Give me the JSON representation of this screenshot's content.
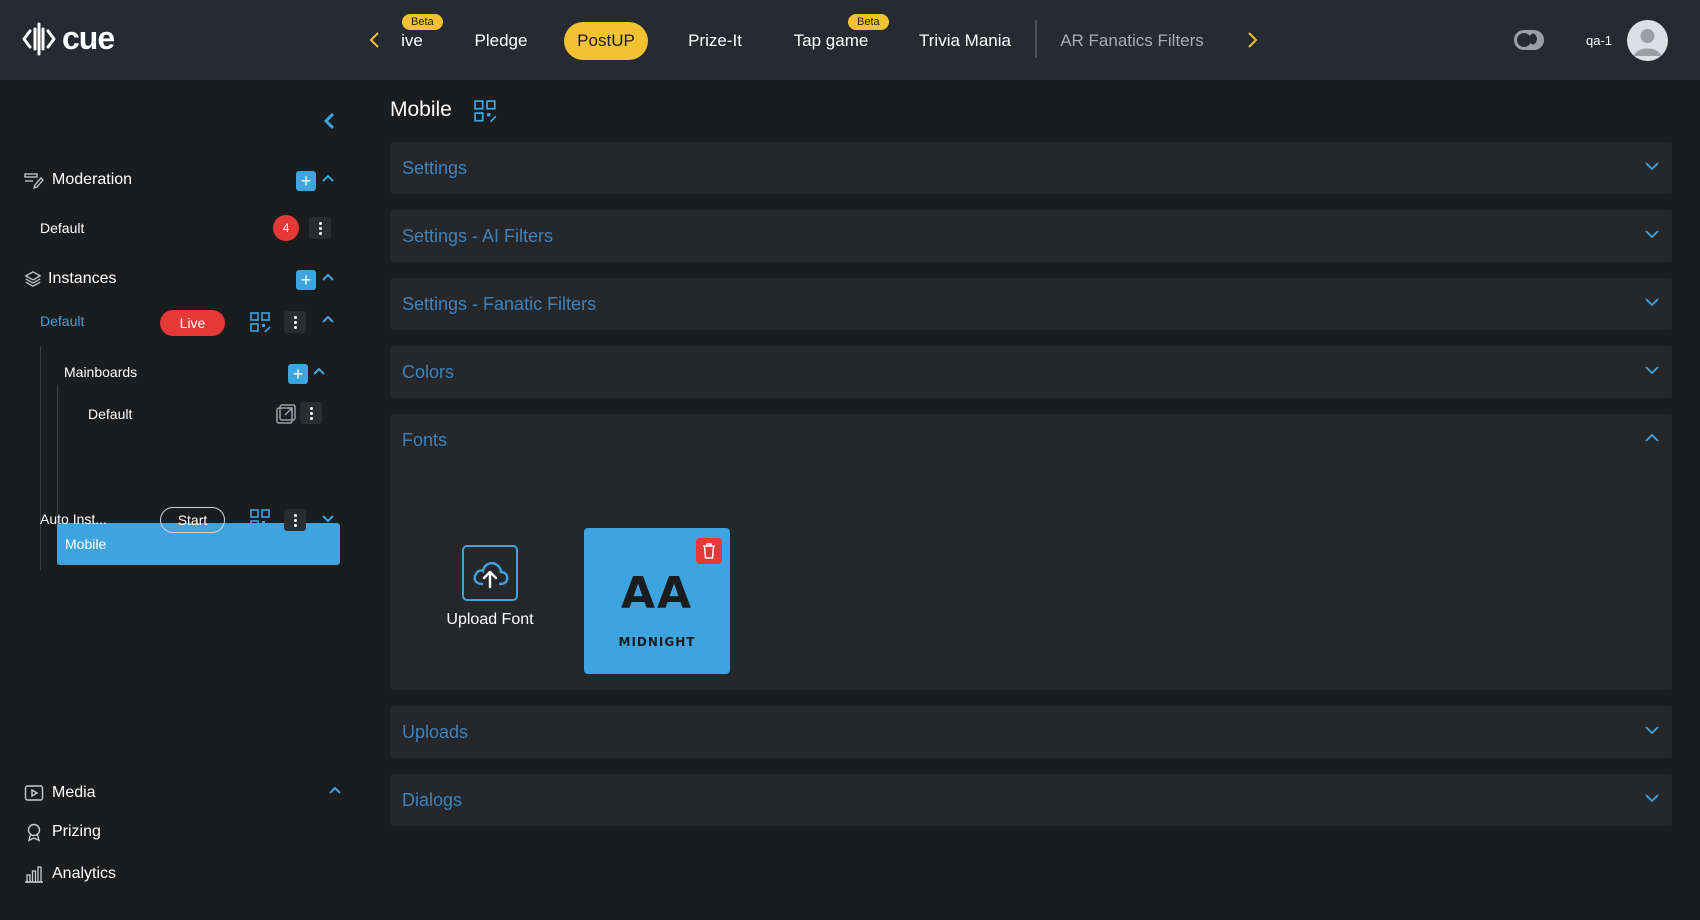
{
  "app": {
    "logo_text": "cue"
  },
  "topnav": {
    "tabs": [
      {
        "label": "ive",
        "beta": "Beta"
      },
      {
        "label": "Pledge"
      },
      {
        "label": "PostUP"
      },
      {
        "label": "Prize-It"
      },
      {
        "label": "Tap game",
        "beta": "Beta"
      },
      {
        "label": "Trivia Mania"
      },
      {
        "label": "AR Fanatics Filters"
      }
    ],
    "user": "qa-1"
  },
  "sidebar": {
    "moderation": {
      "label": "Moderation",
      "items": [
        {
          "label": "Default",
          "count": "4"
        }
      ]
    },
    "instances": {
      "label": "Instances",
      "default": {
        "label": "Default",
        "status": "Live"
      },
      "mainboards": {
        "label": "Mainboards",
        "items": [
          {
            "label": "Default"
          },
          {
            "label": "Mobile"
          }
        ]
      },
      "auto": {
        "label": "Auto Inst...",
        "action": "Start"
      }
    },
    "bottom": [
      {
        "label": "Media"
      },
      {
        "label": "Prizing"
      },
      {
        "label": "Analytics"
      }
    ]
  },
  "main": {
    "title": "Mobile",
    "sections": [
      {
        "label": "Settings"
      },
      {
        "label": "Settings - AI Filters"
      },
      {
        "label": "Settings - Fanatic Filters"
      },
      {
        "label": "Colors"
      },
      {
        "label": "Fonts"
      },
      {
        "label": "Uploads"
      },
      {
        "label": "Dialogs"
      }
    ],
    "fonts": {
      "upload_label": "Upload Font",
      "items": [
        {
          "preview": "AA",
          "name": "MIDNIGHT"
        }
      ]
    }
  },
  "colors": {
    "accent": "#3ea4e0",
    "brand_yellow": "#f2c230",
    "danger": "#e53935",
    "topbar": "#252a33",
    "background": "#1b1c1e"
  }
}
